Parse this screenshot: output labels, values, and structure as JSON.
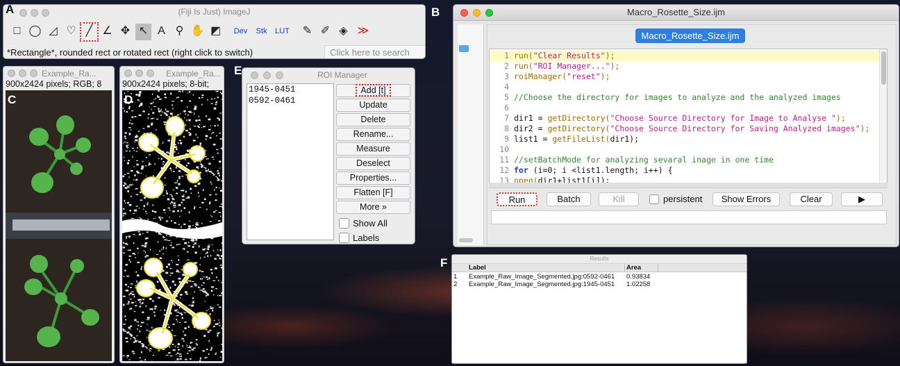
{
  "panel_labels": {
    "a": "A",
    "b": "B",
    "c": "C",
    "d": "D",
    "e": "E",
    "f": "F"
  },
  "imagej": {
    "title": "(Fiji Is Just) ImageJ",
    "tools": [
      "rectangle-tool",
      "oval-tool",
      "polygon-tool",
      "freehand-tool",
      "line-tool",
      "angle-tool",
      "point-tool",
      "wand-tool",
      "text-tool",
      "magnifier-tool",
      "scroll-tool",
      "color-picker-tool",
      "dev-menu",
      "stk-menu",
      "lut-menu",
      "pencil-tool",
      "brush-tool",
      "flood-fill-tool",
      "more-tools"
    ],
    "dev_label": "Dev",
    "stk_label": "Stk",
    "lut_label": "LUT",
    "status": "*Rectangle*, rounded rect or rotated rect (right click to switch)",
    "search_placeholder": "Click here to search"
  },
  "image_c": {
    "title": "Example_Ra...",
    "info": "900x2424 pixels; RGB; 8"
  },
  "image_d": {
    "title": "Example_Ra...",
    "info": "900x2424 pixels; 8-bit;"
  },
  "roi_manager": {
    "title": "ROI Manager",
    "list": [
      "1945-0451",
      "0592-0461"
    ],
    "buttons": [
      "Add [t]",
      "Update",
      "Delete",
      "Rename...",
      "Measure",
      "Deselect",
      "Properties...",
      "Flatten [F]",
      "More »"
    ],
    "show_all": "Show All",
    "labels": "Labels"
  },
  "macro": {
    "title": "Macro_Rosette_Size.ijm",
    "tab": "Macro_Rosette_Size.ijm",
    "buttons": {
      "run": "Run",
      "batch": "Batch",
      "kill": "Kill",
      "persistent": "persistent",
      "show_errors": "Show Errors",
      "clear": "Clear",
      "play": "▶"
    },
    "code": [
      {
        "n": "1",
        "parts": [
          [
            "fn",
            "run("
          ],
          [
            "st",
            "\"Clear Results\""
          ],
          [
            "fn",
            ");"
          ]
        ]
      },
      {
        "n": "2",
        "parts": [
          [
            "fn",
            "run("
          ],
          [
            "st",
            "\"ROI Manager...\""
          ],
          [
            "fn",
            ");"
          ]
        ]
      },
      {
        "n": "3",
        "parts": [
          [
            "fn",
            "roiManager("
          ],
          [
            "st",
            "\"reset\""
          ],
          [
            "fn",
            ");"
          ]
        ]
      },
      {
        "n": "4",
        "parts": []
      },
      {
        "n": "5",
        "parts": [
          [
            "cm",
            "//Choose the directory for images to analyze and the analyzed images"
          ]
        ]
      },
      {
        "n": "6",
        "parts": []
      },
      {
        "n": "7",
        "parts": [
          [
            "",
            "dir1 = "
          ],
          [
            "fn",
            "getDirectory("
          ],
          [
            "st",
            "\"Choose Source Directory for Image to Analyse \""
          ],
          [
            "fn",
            ");"
          ]
        ]
      },
      {
        "n": "8",
        "parts": [
          [
            "",
            "dir2 = "
          ],
          [
            "fn",
            "getDirectory("
          ],
          [
            "st",
            "\"Choose Source Directory for Saving Analyzed images\""
          ],
          [
            "fn",
            ");"
          ]
        ]
      },
      {
        "n": "9",
        "parts": [
          [
            "",
            "list1 = "
          ],
          [
            "fn",
            "getFileList("
          ],
          [
            "",
            "dir1);"
          ]
        ]
      },
      {
        "n": "10",
        "parts": []
      },
      {
        "n": "11",
        "parts": [
          [
            "cm",
            "//setBatchMode for analyzing sevaral inage in one time"
          ]
        ]
      },
      {
        "n": "12",
        "parts": [
          [
            "kw",
            "for"
          ],
          [
            "",
            " (i=0; i <list1.length; i++) {"
          ]
        ]
      },
      {
        "n": "13",
        "parts": [
          [
            "fn",
            "open("
          ],
          [
            "",
            "dir1+list1[i]);"
          ]
        ]
      }
    ]
  },
  "results": {
    "title": "Results",
    "headers": [
      "",
      "Label",
      "Area"
    ],
    "rows": [
      [
        "1",
        "Example_Raw_Image_Segmented.jpg:0592-0461",
        "0.93834"
      ],
      [
        "2",
        "Example_Raw_Image_Segmented.jpg:1945-0451",
        "1.02258"
      ]
    ]
  },
  "colors": {
    "highlight_line": "#fdfbc3",
    "tab_blue": "#2f7fe0",
    "dotted_red": "#e02020",
    "plant_green": "#4fb04a",
    "overlay_yellow": "#f2dc1f"
  }
}
